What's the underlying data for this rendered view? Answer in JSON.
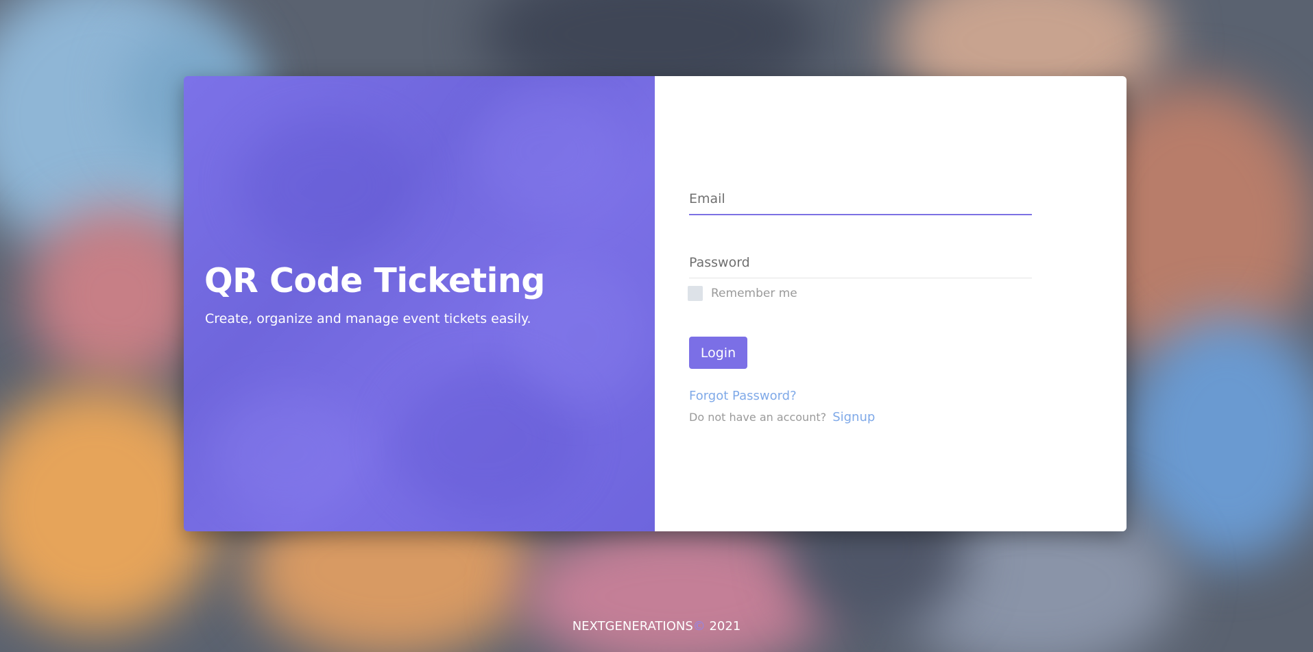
{
  "hero": {
    "title": "QR Code Ticketing",
    "subtitle": "Create, organize and manage event tickets easily."
  },
  "form": {
    "email_placeholder": "Email",
    "password_placeholder": "Password",
    "remember_label": "Remember me",
    "remember_checked": false,
    "login_label": "Login",
    "forgot_label": "Forgot Password?",
    "signup_prompt": "Do not have an account?",
    "signup_label": "Signup"
  },
  "footer": {
    "brand": "NEXTGENERATIONS",
    "copyright_symbol": "©",
    "year": "2021"
  },
  "colors": {
    "accent": "#7b6fe6",
    "link": "#7fa9e8",
    "hero_bg": "#7469e0"
  }
}
